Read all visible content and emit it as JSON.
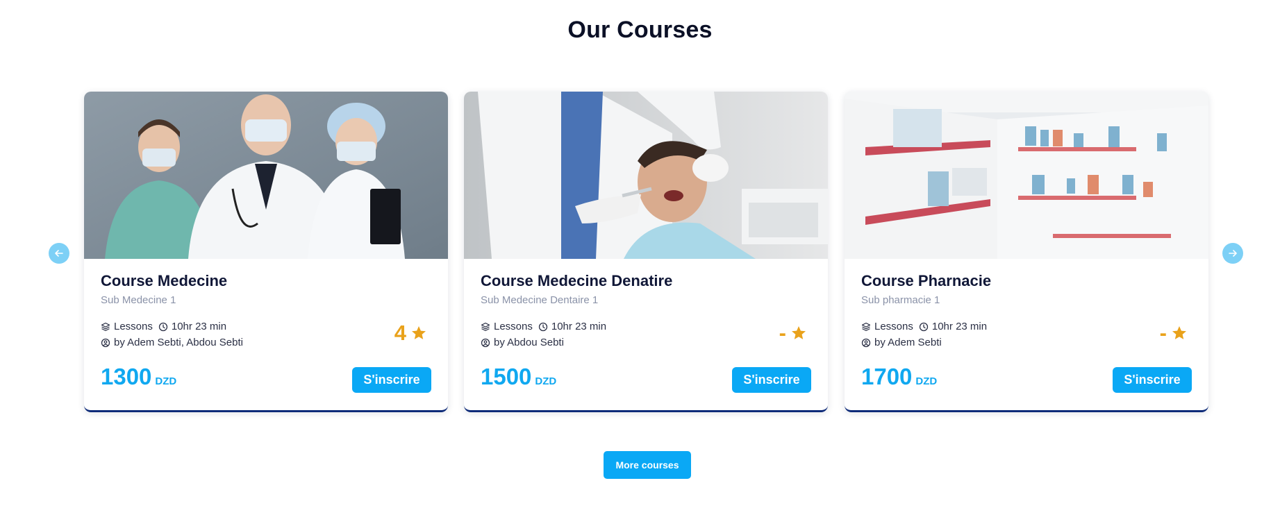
{
  "section": {
    "title": "Our Courses"
  },
  "colors": {
    "accent": "#0aa8f5",
    "rating": "#e9a21b",
    "arrow": "#7dd0f6",
    "card_border": "#0d2a78"
  },
  "carousel": {
    "prev_icon": "arrow-left-icon",
    "next_icon": "arrow-right-icon"
  },
  "courses": [
    {
      "title": "Course Medecine",
      "subtitle": "Sub Medecine 1",
      "lessons": "Lessons",
      "duration": "10hr 23 min",
      "authors": "by Adem Sebti, Abdou Sebti",
      "rating": "4",
      "price": "1300",
      "currency": "DZD",
      "enroll_label": "S'inscrire",
      "image": "medical-staff-photo"
    },
    {
      "title": "Course Medecine Denatire",
      "subtitle": "Sub Medecine Dentaire 1",
      "lessons": "Lessons",
      "duration": "10hr 23 min",
      "authors": "by Abdou Sebti",
      "rating": "-",
      "price": "1500",
      "currency": "DZD",
      "enroll_label": "S'inscrire",
      "image": "dentist-patient-photo"
    },
    {
      "title": "Course Pharnacie",
      "subtitle": "Sub pharmacie 1",
      "lessons": "Lessons",
      "duration": "10hr 23 min",
      "authors": "by Adem Sebti",
      "rating": "-",
      "price": "1700",
      "currency": "DZD",
      "enroll_label": "S'inscrire",
      "image": "pharmacy-shelves-photo"
    }
  ],
  "more_button": {
    "label": "More courses"
  }
}
